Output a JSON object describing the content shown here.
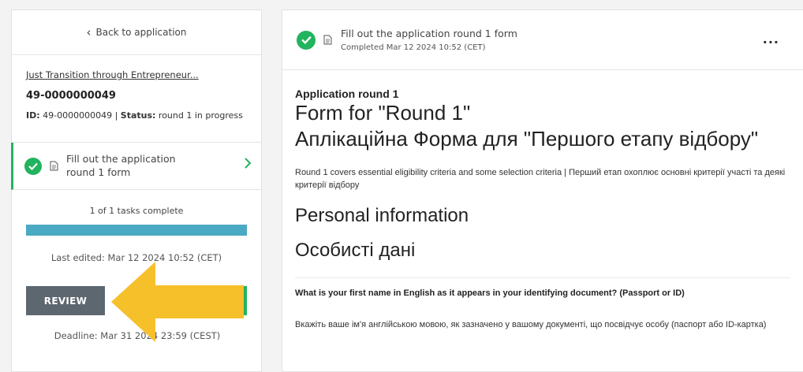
{
  "sidebar": {
    "back_label": "Back to application",
    "app_name": "Just Transition through Entrepreneur...",
    "app_number": "49-0000000049",
    "id_label": "ID:",
    "id_value": "49-0000000049",
    "status_label": "Status:",
    "status_value": "round 1 in progress",
    "task_label": "Fill out the application round 1 form",
    "progress_text": "1 of 1 tasks complete",
    "progress_fraction": 1.0,
    "last_edited": "Last edited: Mar 12 2024 10:52 (CET)",
    "review_label": "REVIEW",
    "deadline": "Deadline: Mar 31 2024 23:59 (CEST)"
  },
  "task_header": {
    "title": "Fill out the application round 1 form",
    "completed": "Completed Mar 12 2024 10:52 (CET)",
    "more": "..."
  },
  "form": {
    "round": "Application round 1",
    "title_en": "Form for \"Round 1\"",
    "title_uk": "Аплікаційна Форма для \"Першого етапу відбору\"",
    "description": "Round 1 covers essential eligibility criteria and some selection criteria | Перший етап охоплює основні критерії участі та деякі критерії відбору",
    "section_en": "Personal information",
    "section_uk": "Особисті дані",
    "question_en": "What is your first name in English as it appears in your identifying document? (Passport or ID)",
    "question_uk": "Вкажіть ваше ім'я англійською мовою, як зазначено у вашому документі, що посвідчує особу (паспорт або ID-картка)"
  },
  "colors": {
    "accent_green": "#22b35e",
    "progress_blue": "#4aa9c3",
    "arrow_yellow": "#f6c02b",
    "button_gray": "#5d6770"
  }
}
